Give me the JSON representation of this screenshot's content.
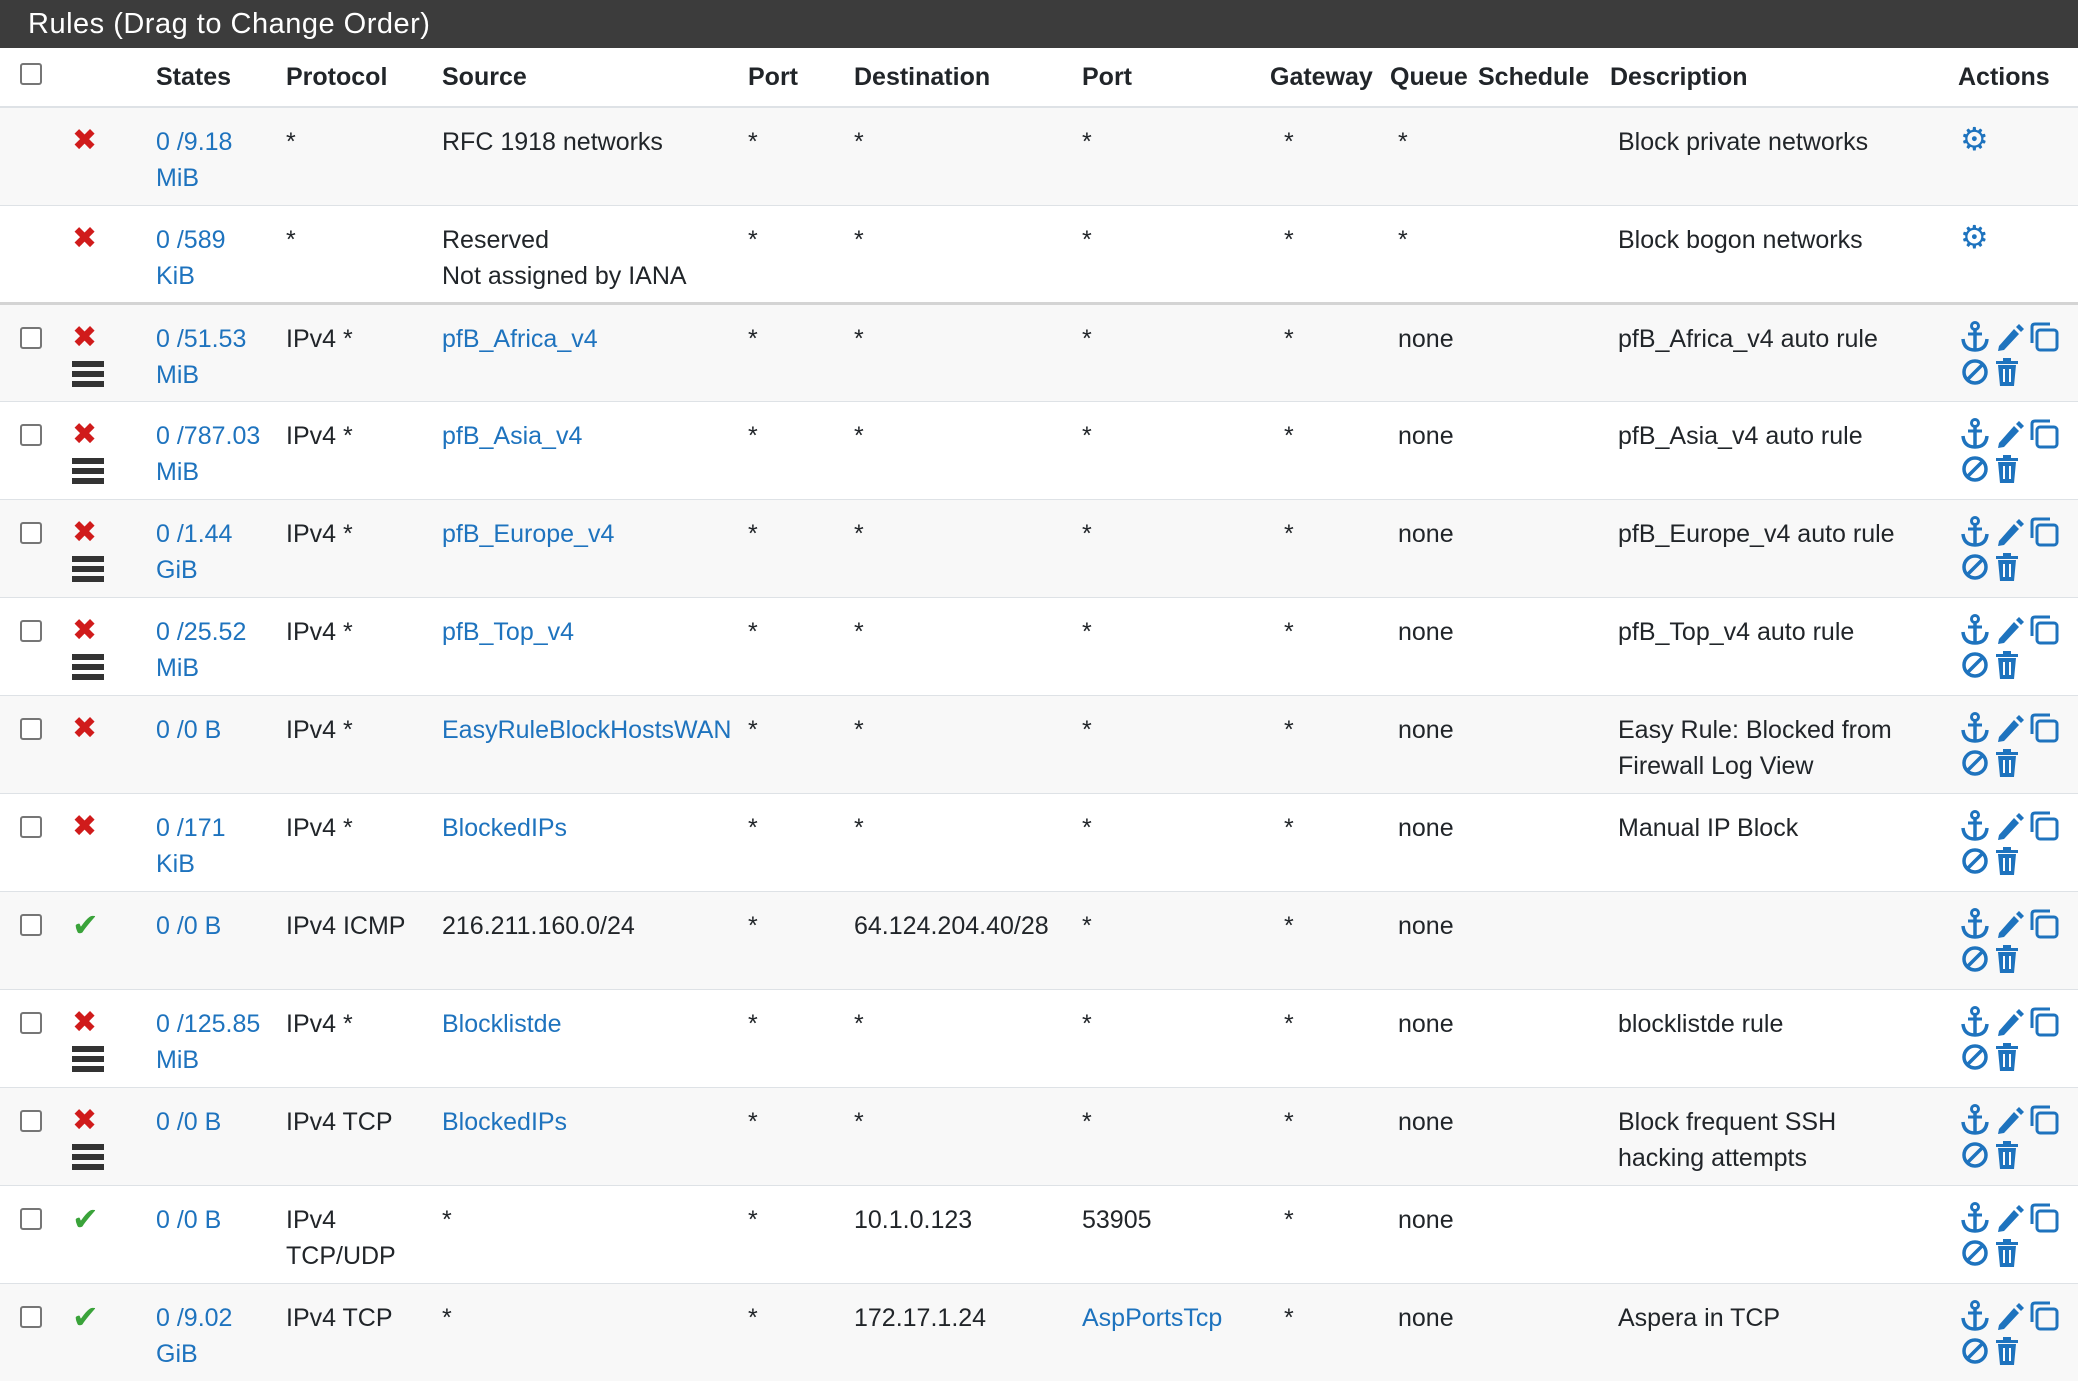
{
  "panel_title": "Rules (Drag to Change Order)",
  "columns": [
    "States",
    "Protocol",
    "Source",
    "Port",
    "Destination",
    "Port",
    "Gateway",
    "Queue",
    "Schedule",
    "Description",
    "Actions"
  ],
  "rows": [
    {
      "states1": "0 /9.18",
      "states2": "MiB",
      "protocol": "*",
      "source": "RFC 1918 networks",
      "source2": "",
      "port": "*",
      "destination": "*",
      "dport": "*",
      "gateway": "*",
      "queue": "*",
      "schedule": "",
      "description": "Block private networks",
      "description2": ""
    },
    {
      "states1": "0 /589",
      "states2": "KiB",
      "protocol": "*",
      "source": "Reserved",
      "source2": "Not assigned by IANA",
      "port": "*",
      "destination": "*",
      "dport": "*",
      "gateway": "*",
      "queue": "*",
      "schedule": "",
      "description": "Block bogon networks",
      "description2": ""
    },
    {
      "states1": "0 /51.53",
      "states2": "MiB",
      "protocol": "IPv4 *",
      "source": "pfB_Africa_v4",
      "port": "*",
      "destination": "*",
      "dport": "*",
      "gateway": "*",
      "queue": "none",
      "schedule": "",
      "description": "pfB_Africa_v4 auto rule",
      "description2": ""
    },
    {
      "states1": "0 /787.03",
      "states2": "MiB",
      "protocol": "IPv4 *",
      "source": "pfB_Asia_v4",
      "port": "*",
      "destination": "*",
      "dport": "*",
      "gateway": "*",
      "queue": "none",
      "schedule": "",
      "description": "pfB_Asia_v4 auto rule",
      "description2": ""
    },
    {
      "states1": "0 /1.44",
      "states2": "GiB",
      "protocol": "IPv4 *",
      "source": "pfB_Europe_v4",
      "port": "*",
      "destination": "*",
      "dport": "*",
      "gateway": "*",
      "queue": "none",
      "schedule": "",
      "description": "pfB_Europe_v4 auto rule",
      "description2": ""
    },
    {
      "states1": "0 /25.52",
      "states2": "MiB",
      "protocol": "IPv4 *",
      "source": "pfB_Top_v4",
      "port": "*",
      "destination": "*",
      "dport": "*",
      "gateway": "*",
      "queue": "none",
      "schedule": "",
      "description": "pfB_Top_v4 auto rule",
      "description2": ""
    },
    {
      "states1": "0 /0 B",
      "states2": "",
      "protocol": "IPv4 *",
      "source": "EasyRuleBlockHostsWAN",
      "port": "*",
      "destination": "*",
      "dport": "*",
      "gateway": "*",
      "queue": "none",
      "schedule": "",
      "description": "Easy Rule: Blocked from",
      "description2": "Firewall Log View"
    },
    {
      "states1": "0 /171",
      "states2": "KiB",
      "protocol": "IPv4 *",
      "source": "BlockedIPs",
      "port": "*",
      "destination": "*",
      "dport": "*",
      "gateway": "*",
      "queue": "none",
      "schedule": "",
      "description": "Manual IP Block",
      "description2": ""
    },
    {
      "states1": "0 /0 B",
      "states2": "",
      "protocol": "IPv4 ICMP",
      "source": "216.211.160.0/24",
      "port": "*",
      "destination": "64.124.204.40/28",
      "dport": "*",
      "gateway": "*",
      "queue": "none",
      "schedule": "",
      "description": "",
      "description2": ""
    },
    {
      "states1": "0 /125.85",
      "states2": "MiB",
      "protocol": "IPv4 *",
      "source": "Blocklistde",
      "port": "*",
      "destination": "*",
      "dport": "*",
      "gateway": "*",
      "queue": "none",
      "schedule": "",
      "description": "blocklistde rule",
      "description2": ""
    },
    {
      "states1": "0 /0 B",
      "states2": "",
      "protocol": "IPv4 TCP",
      "source": "BlockedIPs",
      "port": "*",
      "destination": "*",
      "dport": "*",
      "gateway": "*",
      "queue": "none",
      "schedule": "",
      "description": "Block frequent SSH",
      "description2": "hacking attempts"
    },
    {
      "states1": "0 /0 B",
      "states2": "",
      "protocol": "IPv4",
      "protocol2": "TCP/UDP",
      "source": "*",
      "port": "*",
      "destination": "10.1.0.123",
      "dport": "53905",
      "gateway": "*",
      "queue": "none",
      "schedule": "",
      "description": "",
      "description2": ""
    },
    {
      "states1": "0 /9.02",
      "states2": "GiB",
      "protocol": "IPv4 TCP",
      "source": "*",
      "port": "*",
      "destination": "172.17.1.24",
      "dport": "AspPortsTcp",
      "gateway": "*",
      "queue": "none",
      "schedule": "",
      "description": "Aspera in TCP",
      "description2": ""
    }
  ],
  "icons": {
    "block": "x-icon",
    "pass": "check-icon",
    "log": "log-icon",
    "settings": "gear-icon",
    "anchor": "anchor-icon",
    "edit": "pencil-icon",
    "copy": "copy-icon",
    "disable": "disable-icon",
    "delete": "trash-icon"
  },
  "colors": {
    "header_bg": "#3c3c3c",
    "link": "#1e73be",
    "block": "#d01b1b",
    "pass": "#3aa33a"
  }
}
